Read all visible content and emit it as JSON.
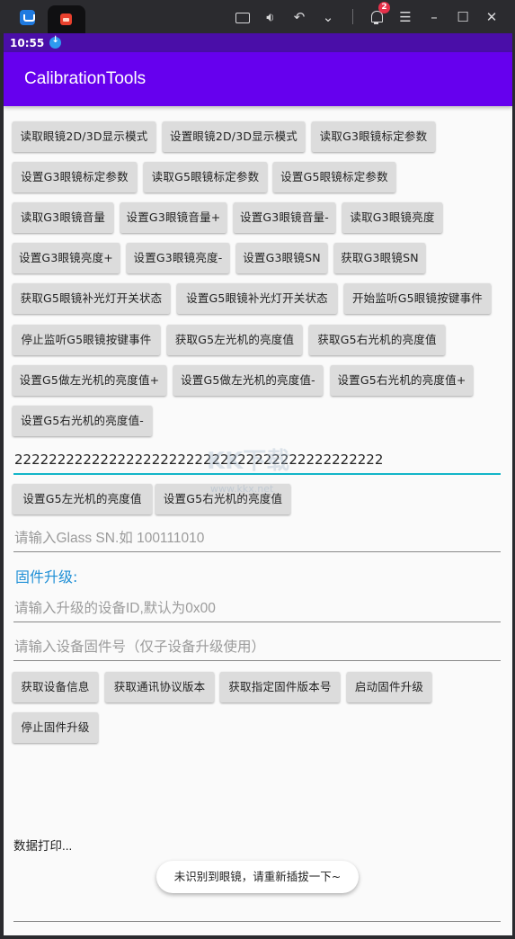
{
  "window": {
    "notification_count": "2",
    "icons": [
      "app-logo-icon",
      "keyboard-icon",
      "volume-icon",
      "undo-icon",
      "chevron-down-icon",
      "bell-icon",
      "menu-icon",
      "minimize-icon",
      "maximize-icon",
      "close-icon"
    ]
  },
  "status": {
    "time": "10:55"
  },
  "app": {
    "title": "CalibrationTools"
  },
  "buttons": [
    "读取眼镜2D/3D显示模式",
    "设置眼镜2D/3D显示模式",
    "读取G3眼镜标定参数",
    "设置G3眼镜标定参数",
    "读取G5眼镜标定参数",
    "设置G5眼镜标定参数",
    "读取G3眼镜音量",
    "设置G3眼镜音量+",
    "设置G3眼镜音量-",
    "读取G3眼镜亮度",
    "设置G3眼镜亮度+",
    "设置G3眼镜亮度-",
    "设置G3眼镜SN",
    "获取G3眼镜SN",
    "获取G5眼镜补光灯开关状态",
    "设置G5眼镜补光灯开关状态",
    "开始监听G5眼镜按键事件",
    "停止监听G5眼镜按键事件",
    "获取G5左光机的亮度值",
    "获取G5右光机的亮度值",
    "设置G5做左光机的亮度值+",
    "设置G5做左光机的亮度值-",
    "设置G5右光机的亮度值+",
    "设置G5右光机的亮度值-"
  ],
  "brightness_input": {
    "value": "2222222222222222222222222222222222222222222"
  },
  "brightness_buttons": [
    "设置G5左光机的亮度值",
    "设置G5右光机的亮度值"
  ],
  "sn_input": {
    "placeholder": "请输入Glass SN.如 100111010"
  },
  "firmware": {
    "section_title": "固件升级:",
    "device_id_placeholder": "请输入升级的设备ID,默认为0x00",
    "firmware_no_placeholder": "请输入设备固件号（仅子设备升级使用）",
    "buttons": [
      "获取设备信息",
      "获取通讯协议版本",
      "获取指定固件版本号",
      "启动固件升级",
      "停止固件升级"
    ]
  },
  "log": {
    "label": "数据打印..."
  },
  "toast": {
    "message": "未识别到眼镜，请重新插拔一下~"
  },
  "watermark": {
    "text": "KK下载",
    "sub": "www.kkx.net"
  },
  "colors": {
    "status_bar": "#4a0ea8",
    "app_bar": "#6600ee",
    "accent": "#12b5c8",
    "section": "#1e8fd6"
  }
}
